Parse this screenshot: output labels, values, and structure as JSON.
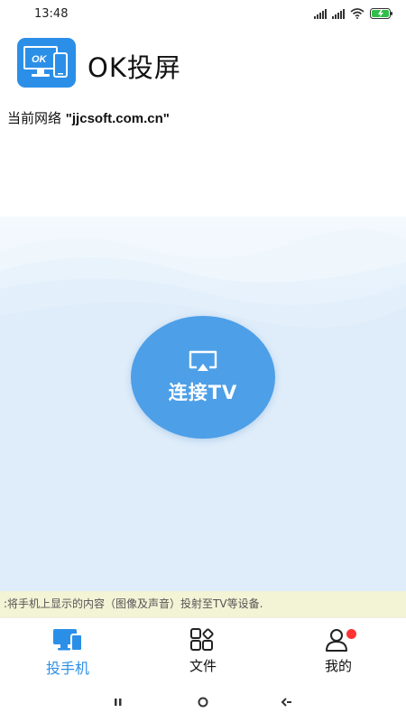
{
  "status_bar": {
    "time": "13:48",
    "icons": [
      "signal-icon",
      "wifi-icon",
      "battery-charging-icon"
    ]
  },
  "header": {
    "logo_text": "OK",
    "title": "OK投屏"
  },
  "network": {
    "prefix": "当前网络 ",
    "name": "\"jjcsoft.com.cn\""
  },
  "connect_button": {
    "label": "连接TV",
    "icon": "cast-icon",
    "color": "#4d9fe8"
  },
  "marquee": {
    "text": ":将手机上显示的内容（图像及声音）投射至TV等设备."
  },
  "bottom_nav": {
    "items": [
      {
        "label": "投手机",
        "icon": "screen-cast-icon",
        "active": true
      },
      {
        "label": "文件",
        "icon": "file-grid-icon",
        "active": false
      },
      {
        "label": "我的",
        "icon": "user-icon",
        "active": false,
        "badge": true
      }
    ],
    "accent": "#2b8fe8"
  },
  "system_nav": {
    "buttons": [
      "recent-apps-icon",
      "home-icon",
      "back-icon"
    ]
  }
}
